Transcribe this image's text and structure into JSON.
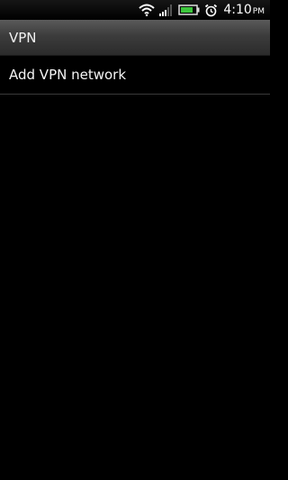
{
  "status_bar": {
    "time": "4:10",
    "ampm": "PM",
    "icons": [
      "wifi-icon",
      "signal-icon",
      "battery-icon",
      "alarm-icon"
    ],
    "battery_color": "#3cc63c"
  },
  "header": {
    "title": "VPN"
  },
  "list": {
    "items": [
      {
        "label": "Add VPN network"
      }
    ]
  },
  "colors": {
    "background": "#000000",
    "title_bar": "#3c3c3c",
    "divider": "#3a3a3a"
  }
}
